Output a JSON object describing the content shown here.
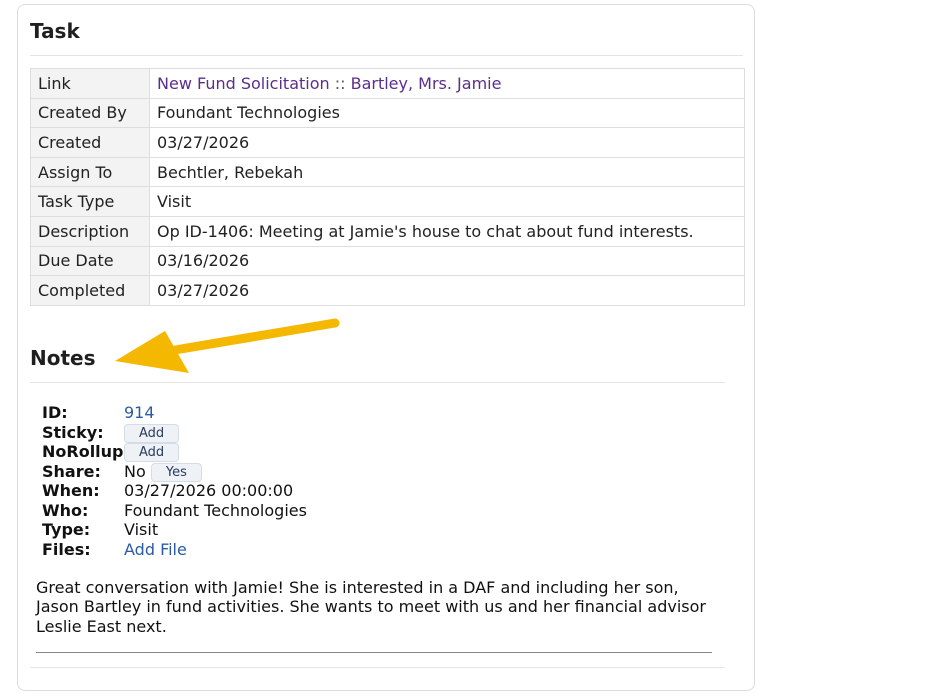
{
  "task": {
    "title": "Task",
    "rows": {
      "link_label": "Link",
      "link_fund": "New Fund Solicitation",
      "link_sep": " :: ",
      "link_person": "Bartley, Mrs. Jamie",
      "created_by_label": "Created By",
      "created_by_value": "Foundant Technologies",
      "created_label": "Created",
      "created_value": "03/27/2026",
      "assign_label": "Assign To",
      "assign_value": "Bechtler, Rebekah",
      "type_label": "Task Type",
      "type_value": "Visit",
      "desc_label": "Description",
      "desc_value": "Op ID-1406: Meeting at Jamie's house to chat about fund interests.",
      "due_label": "Due Date",
      "due_value": "03/16/2026",
      "completed_label": "Completed",
      "completed_value": "03/27/2026"
    }
  },
  "notes": {
    "title": "Notes",
    "meta": {
      "id_label": "ID:",
      "id_value": "914",
      "sticky_label": "Sticky:",
      "sticky_button": "Add",
      "norollup_label": "NoRollup:",
      "norollup_button": "Add",
      "share_label": "Share:",
      "share_value": "No",
      "share_button": "Yes",
      "when_label": "When:",
      "when_value": "03/27/2026 00:00:00",
      "who_label": "Who:",
      "who_value": "Foundant Technologies",
      "type_label": "Type:",
      "type_value": "Visit",
      "files_label": "Files:",
      "files_link": "Add File"
    },
    "body": "Great conversation with Jamie! She is interested in a DAF and including her son, Jason Bartley in fund activities. She wants to meet with us and her financial advisor Leslie East next."
  },
  "colors": {
    "arrow": "#f5b800",
    "link_purple": "#5b2e8c",
    "link_blue": "#2b5aa6"
  },
  "icons": {
    "annotation": "arrow-icon"
  }
}
